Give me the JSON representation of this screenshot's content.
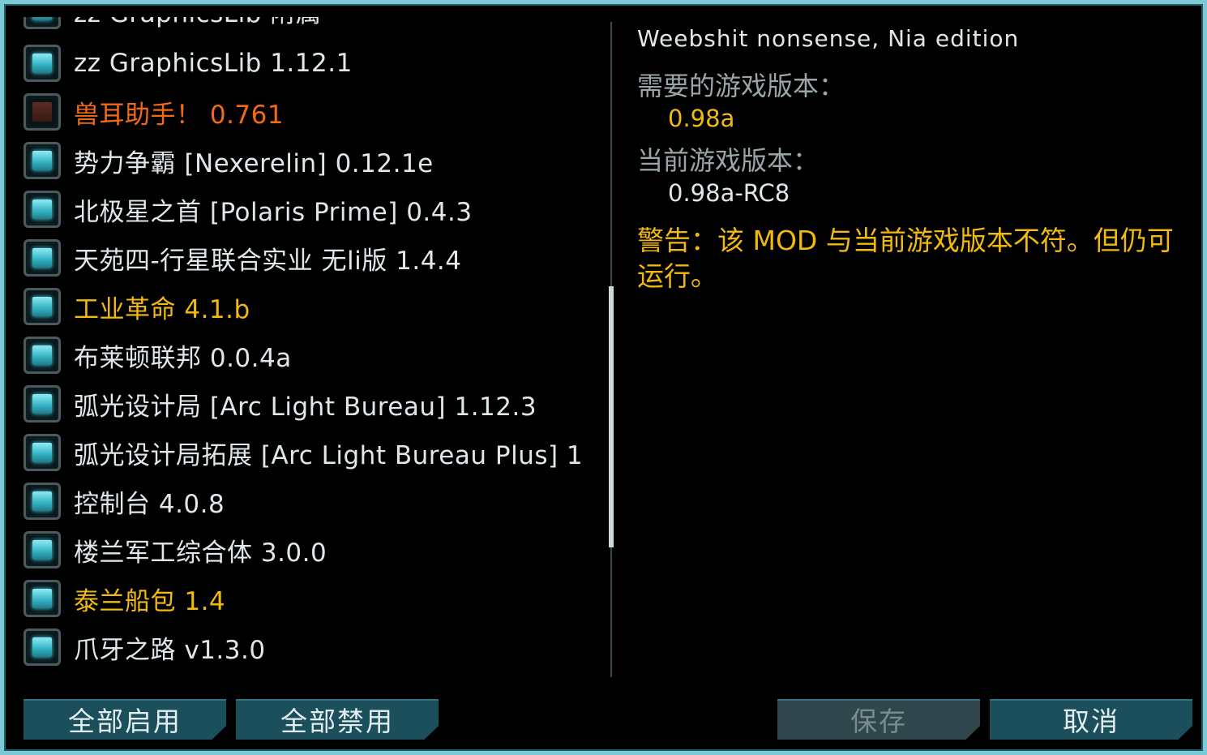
{
  "mod_list": {
    "partial_top": "zz GraphicsLib 附属",
    "items": [
      {
        "name": "zz GraphicsLib 1.12.1",
        "enabled": true,
        "status": "normal"
      },
      {
        "name": "兽耳助手！   0.761",
        "enabled": false,
        "status": "error"
      },
      {
        "name": "势力争霸 [Nexerelin] 0.12.1e",
        "enabled": true,
        "status": "normal"
      },
      {
        "name": "北极星之首 [Polaris Prime] 0.4.3",
        "enabled": true,
        "status": "normal"
      },
      {
        "name": "天苑四-行星联合实业 无li版 1.4.4",
        "enabled": true,
        "status": "normal"
      },
      {
        "name": "工业革命 4.1.b",
        "enabled": true,
        "status": "warn"
      },
      {
        "name": "布莱顿联邦 0.0.4a",
        "enabled": true,
        "status": "normal"
      },
      {
        "name": "弧光设计局 [Arc Light Bureau] 1.12.3",
        "enabled": true,
        "status": "normal"
      },
      {
        "name": "弧光设计局拓展 [Arc Light Bureau Plus] 1",
        "enabled": true,
        "status": "normal"
      },
      {
        "name": "控制台 4.0.8",
        "enabled": true,
        "status": "normal"
      },
      {
        "name": "楼兰军工综合体 3.0.0",
        "enabled": true,
        "status": "normal"
      },
      {
        "name": "泰兰船包 1.4",
        "enabled": true,
        "status": "warn"
      },
      {
        "name": "爪牙之路 v1.3.0",
        "enabled": true,
        "status": "normal"
      }
    ]
  },
  "detail": {
    "mod_name": "Weebshit nonsense, Nia edition",
    "required_label": "需要的游戏版本：",
    "required_value": "0.98a",
    "current_label": "当前游戏版本：",
    "current_value": "0.98a-RC8",
    "warning": "警告：该 MOD 与当前游戏版本不符。但仍可运行。"
  },
  "buttons": {
    "enable_all": "全部启用",
    "disable_all": "全部禁用",
    "save": "保存",
    "cancel": "取消"
  },
  "colors": {
    "frame": "#7cc8d4",
    "warn": "#f2b90e",
    "error": "#f36a14",
    "button": "#1b4f5b"
  }
}
